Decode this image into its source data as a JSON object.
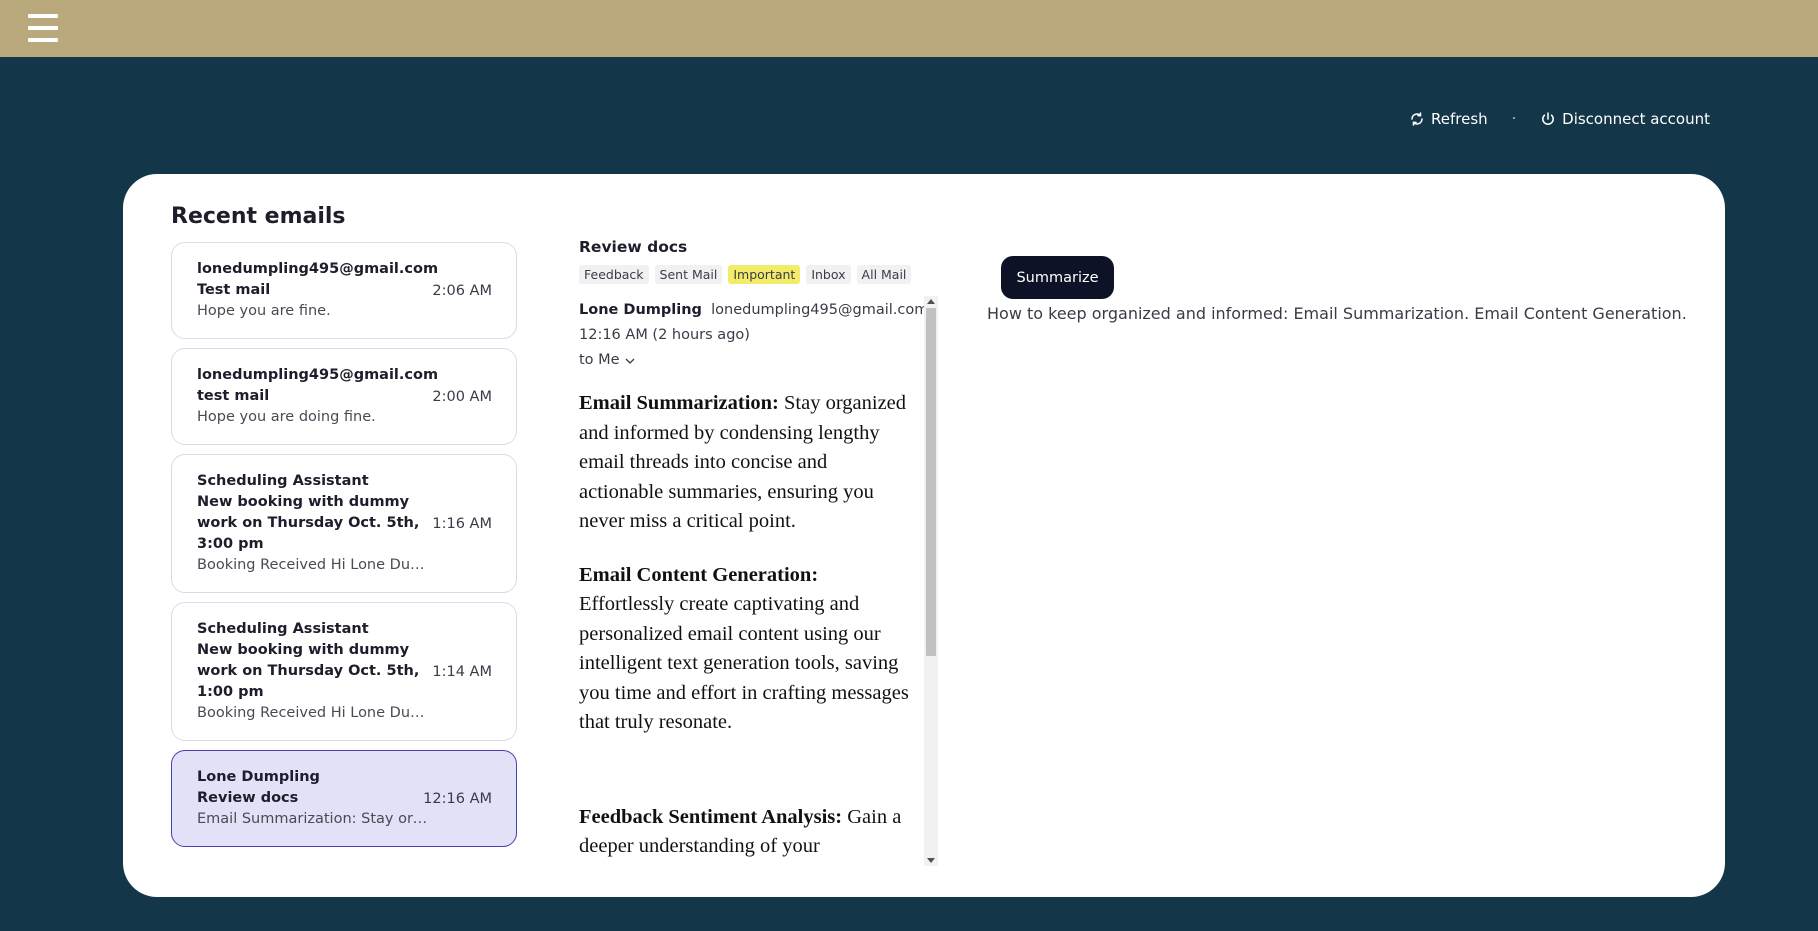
{
  "header": {
    "menu_icon": "hamburger-menu-icon",
    "background_color": "#b9a97c"
  },
  "actions": {
    "refresh_label": "Refresh",
    "separator": "·",
    "disconnect_label": "Disconnect account"
  },
  "section_title": "Recent emails",
  "emails": [
    {
      "sender": "lonedumpling495@gmail.com",
      "subject": "Test mail",
      "preview": "Hope you are fine.",
      "time": "2:06 AM",
      "selected": false
    },
    {
      "sender": "lonedumpling495@gmail.com",
      "subject": "test mail",
      "preview": "Hope you are doing fine.",
      "time": "2:00 AM",
      "selected": false
    },
    {
      "sender": "Scheduling Assistant",
      "subject": "New booking with dummy work on Thursday Oct. 5th, 3:00 pm",
      "preview": "Booking Received Hi Lone Dump...",
      "time": "1:16 AM",
      "selected": false
    },
    {
      "sender": "Scheduling Assistant",
      "subject": "New booking with dummy work on Thursday Oct. 5th, 1:00 pm",
      "preview": "Booking Received Hi Lone Dump...",
      "time": "1:14 AM",
      "selected": false
    },
    {
      "sender": "Lone Dumpling",
      "subject": "Review docs",
      "preview": "Email Summarization: Stay org...",
      "time": "12:16 AM",
      "selected": true
    }
  ],
  "detail": {
    "subject": "Review docs",
    "labels": [
      "Feedback",
      "Sent Mail",
      "Important",
      "Inbox",
      "All Mail"
    ],
    "highlighted_label": "Important",
    "from_name": "Lone Dumpling",
    "from_email": "lonedumpling495@gmail.com",
    "datetime": "12:16 AM (2 hours ago)",
    "to": "to Me",
    "body": [
      {
        "heading": "Email Summarization:",
        "text": " Stay organized and informed by condensing lengthy email threads into concise and actionable summaries, ensuring you never miss a critical point."
      },
      {
        "heading": "Email Content Generation:",
        "text": " Effortlessly create captivating and personalized email content using our intelligent text generation tools, saving you time and effort in crafting messages that truly resonate."
      },
      {
        "heading": "Feedback Sentiment Analysis:",
        "text": " Gain a deeper understanding of your"
      }
    ]
  },
  "summarize": {
    "button_label": "Summarize",
    "result": "How to keep organized and informed: Email Summarization. Email Content Generation."
  },
  "colors": {
    "page_background": "#133748",
    "selected_item": "#e1e1f8",
    "important_label": "#f3ec6a",
    "button": "#0d1226"
  }
}
